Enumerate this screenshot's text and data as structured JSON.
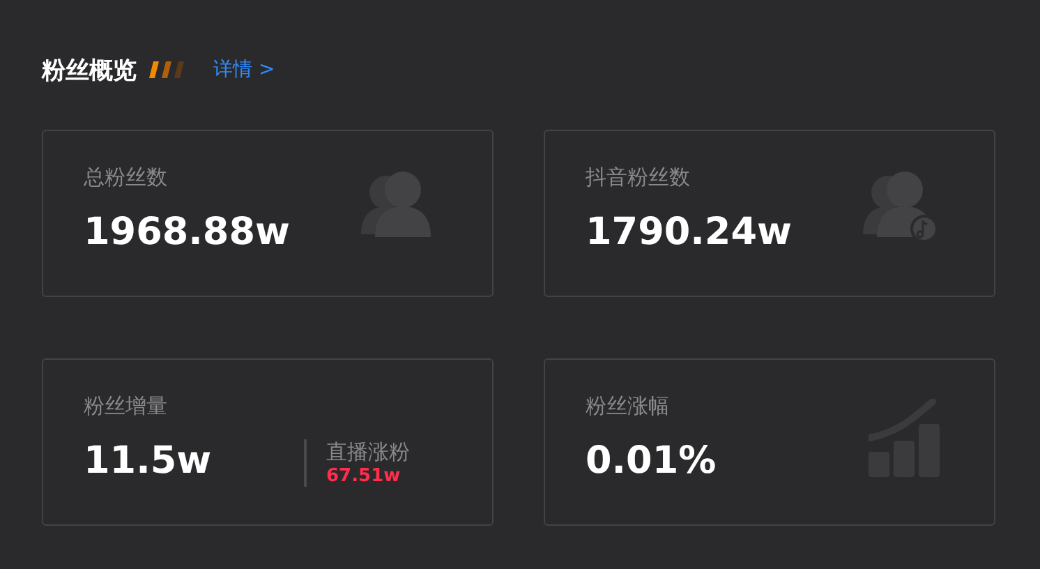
{
  "section": {
    "title": "粉丝概览",
    "link": "详情 >"
  },
  "cards": [
    {
      "kind": "users",
      "label": "总粉丝数",
      "value": "1968.88w"
    },
    {
      "kind": "users-note",
      "label": "抖音粉丝数",
      "value": "1790.24w"
    },
    {
      "kind": "plain",
      "label": "粉丝增量",
      "value": "11.5w",
      "sub": {
        "label": "直播涨粉",
        "value": "67.51w"
      }
    },
    {
      "kind": "chart",
      "label": "粉丝涨幅",
      "value": "0.01%"
    }
  ]
}
